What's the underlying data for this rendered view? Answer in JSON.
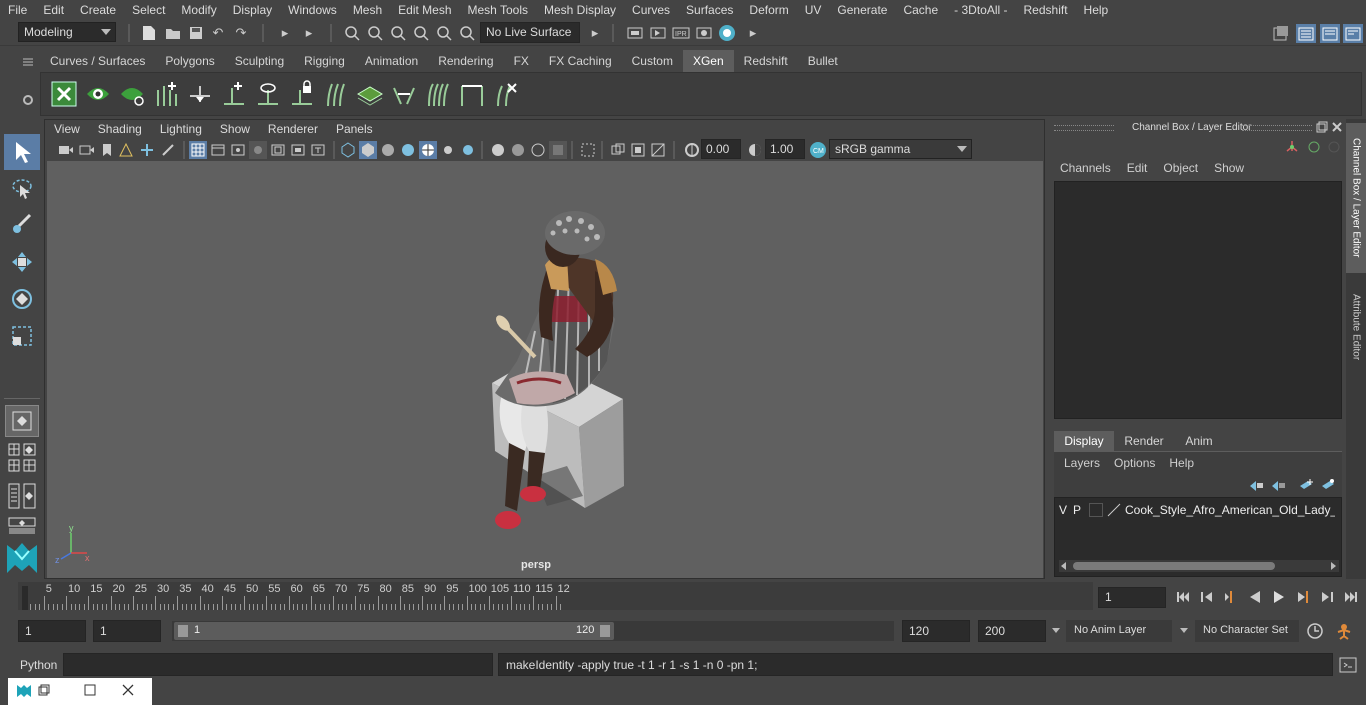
{
  "menu": [
    "File",
    "Edit",
    "Create",
    "Select",
    "Modify",
    "Display",
    "Windows",
    "Mesh",
    "Edit Mesh",
    "Mesh Tools",
    "Mesh Display",
    "Curves",
    "Surfaces",
    "Deform",
    "UV",
    "Generate",
    "Cache",
    "- 3DtoAll -",
    "Redshift",
    "Help"
  ],
  "status": {
    "mode": "Modeling",
    "live_surface": "No Live Surface"
  },
  "shelf_tabs": [
    "Curves / Surfaces",
    "Polygons",
    "Sculpting",
    "Rigging",
    "Animation",
    "Rendering",
    "FX",
    "FX Caching",
    "Custom",
    "XGen",
    "Redshift",
    "Bullet"
  ],
  "active_shelf": "XGen",
  "panel_menu": [
    "View",
    "Shading",
    "Lighting",
    "Show",
    "Renderer",
    "Panels"
  ],
  "panel_toolbar": {
    "exposure": "0.00",
    "gamma": "1.00",
    "color_space": "sRGB gamma"
  },
  "viewport": {
    "camera_label": "persp"
  },
  "channel_box": {
    "title": "Channel Box / Layer Editor",
    "menu": [
      "Channels",
      "Edit",
      "Object",
      "Show"
    ],
    "layer_tabs": [
      "Display",
      "Render",
      "Anim"
    ],
    "active_layer_tab": "Display",
    "layer_menu": [
      "Layers",
      "Options",
      "Help"
    ],
    "layer": {
      "v": "V",
      "p": "P",
      "name": "Cook_Style_Afro_American_Old_Lady_Sitti"
    }
  },
  "side_tabs": [
    "Channel Box / Layer Editor",
    "Attribute Editor"
  ],
  "timeline": {
    "ticks": [
      "5",
      "10",
      "15",
      "20",
      "25",
      "30",
      "35",
      "40",
      "45",
      "50",
      "55",
      "60",
      "65",
      "70",
      "75",
      "80",
      "85",
      "90",
      "95",
      "100",
      "105",
      "110",
      "115",
      "12"
    ],
    "start_label": "1",
    "current_frame": "1"
  },
  "range": {
    "start": "1",
    "anim_start": "1",
    "slider_start": "1",
    "slider_end": "120",
    "end": "120",
    "anim_end": "200",
    "anim_layer": "No Anim Layer",
    "character_set": "No Character Set"
  },
  "command": {
    "lang": "Python",
    "input": "",
    "feedback": "makeIdentity -apply true -t 1 -r 1 -s 1 -n 0 -pn 1;"
  }
}
